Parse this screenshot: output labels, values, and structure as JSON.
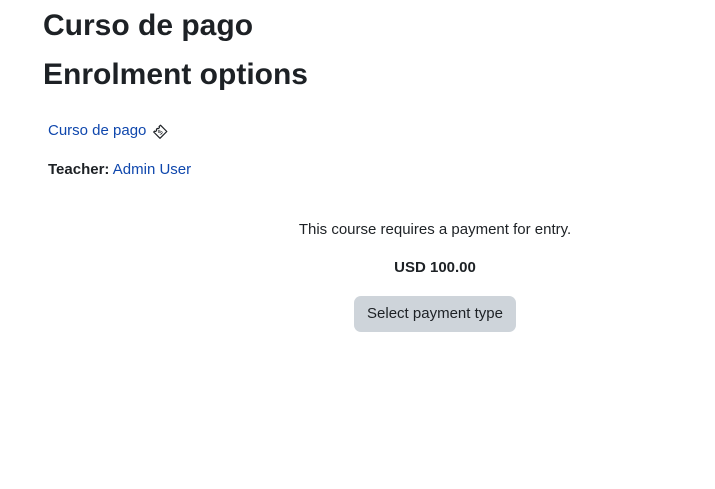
{
  "header": {
    "course_title": "Curso de pago",
    "section_title": "Enrolment options"
  },
  "course_info": {
    "course_link_label": "Curso de pago",
    "icon": "ticket-icon",
    "teacher_label": "Teacher:",
    "teacher_name": "Admin User"
  },
  "payment": {
    "message": "This course requires a payment for entry.",
    "cost": "USD 100.00",
    "button_label": "Select payment type"
  },
  "colors": {
    "link": "#0f47ad",
    "button_bg": "#ced4da",
    "text": "#1d2125"
  }
}
